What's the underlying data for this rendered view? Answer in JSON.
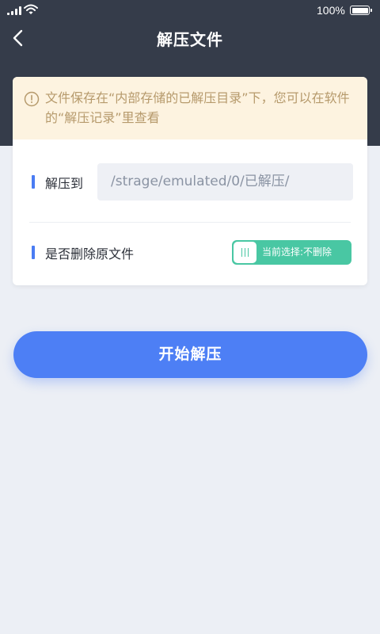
{
  "status_bar": {
    "battery_percent": "100%"
  },
  "nav": {
    "title": "解压文件",
    "back_icon": "chevron-left-icon"
  },
  "notice": {
    "icon": "info-circle-icon",
    "text": "文件保存在“内部存储的已解压目录”下，您可以在软件的“解压记录”里查看"
  },
  "extract_to": {
    "label": "解压到",
    "path": "/strage/emulated/0/已解压/"
  },
  "delete_source": {
    "label": "是否删除原文件",
    "toggle_text": "当前选择:不删除",
    "toggle_on": false
  },
  "actions": {
    "start_label": "开始解压"
  },
  "colors": {
    "header": "#353c4a",
    "accent": "#4d7ff5",
    "toggle": "#49c7a3",
    "notice_bg": "#fdf3e0",
    "notice_text": "#b69a6c",
    "page_bg": "#eceff5"
  }
}
